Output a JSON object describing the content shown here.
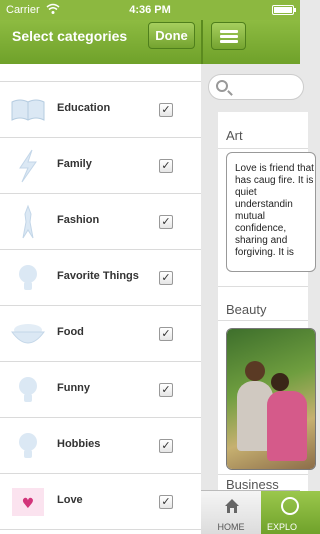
{
  "status": {
    "carrier": "Carrier",
    "time": "4:36 PM"
  },
  "left_panel": {
    "title": "Select categories",
    "done_label": "Done",
    "categories": [
      {
        "label": "Education",
        "icon": "book-icon",
        "checked": true
      },
      {
        "label": "Family",
        "icon": "lightning-icon",
        "checked": true
      },
      {
        "label": "Fashion",
        "icon": "mannequin-icon",
        "checked": true
      },
      {
        "label": "Favorite Things",
        "icon": "lightbulb-icon",
        "checked": true
      },
      {
        "label": "Food",
        "icon": "food-bowl-icon",
        "checked": true
      },
      {
        "label": "Funny",
        "icon": "lightbulb-icon",
        "checked": true
      },
      {
        "label": "Hobbies",
        "icon": "lightbulb-icon",
        "checked": true
      },
      {
        "label": "Love",
        "icon": "love-image-icon",
        "checked": true
      }
    ],
    "check_glyph": "✓"
  },
  "right_panel": {
    "sections": [
      {
        "title": "Art",
        "text": "Love is friend that has caug fire. It is quiet understandin mutual confidence, sharing and forgiving. It is"
      },
      {
        "title": "Beauty"
      },
      {
        "title": "Business"
      }
    ],
    "tabs": [
      {
        "label": "HOME",
        "icon": "home-icon"
      },
      {
        "label": "EXPLO",
        "icon": "globe-icon"
      }
    ]
  },
  "colors": {
    "accent": "#8cb840",
    "accent_dark": "#6fa12a"
  }
}
